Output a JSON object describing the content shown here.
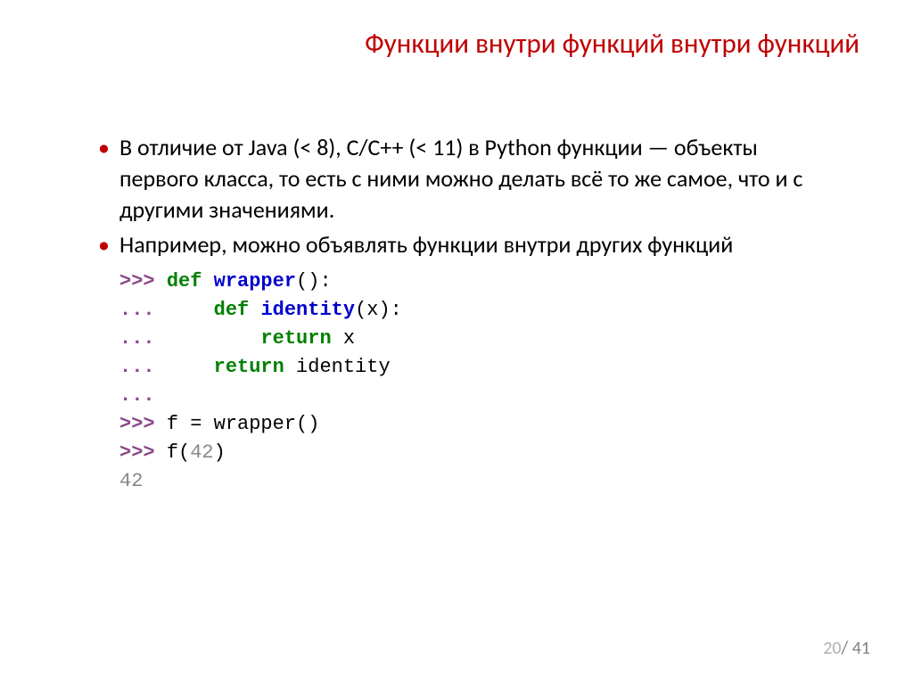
{
  "title": "Функции внутри функций внутри функций",
  "bullets": [
    "В отличие от Java (< 8), C/C++ (< 11) в Python функции — объекты первого класса, то есть с ними можно делать всё то же самое, что и с другими значениями.",
    "Например, можно объявлять функции внутри других функций"
  ],
  "code": {
    "line1": {
      "prompt": ">>> ",
      "keyword": "def",
      "space": " ",
      "name": "wrapper",
      "rest": "():"
    },
    "line2": {
      "prompt": "... ",
      "indent": "    ",
      "keyword": "def",
      "space": " ",
      "name": "identity",
      "rest": "(x):"
    },
    "line3": {
      "prompt": "... ",
      "indent": "        ",
      "keyword": "return",
      "rest": " x"
    },
    "line4": {
      "prompt": "... ",
      "indent": "    ",
      "keyword": "return",
      "rest": " identity"
    },
    "line5": {
      "prompt": "... "
    },
    "line6": {
      "prompt": ">>> ",
      "text": "f = wrapper()"
    },
    "line7": {
      "prompt": ">>> ",
      "text": "f(",
      "arg": "42",
      "close": ")"
    },
    "line8": {
      "result": "42"
    }
  },
  "page": {
    "current": "20",
    "separator": "/ ",
    "total": "41"
  }
}
